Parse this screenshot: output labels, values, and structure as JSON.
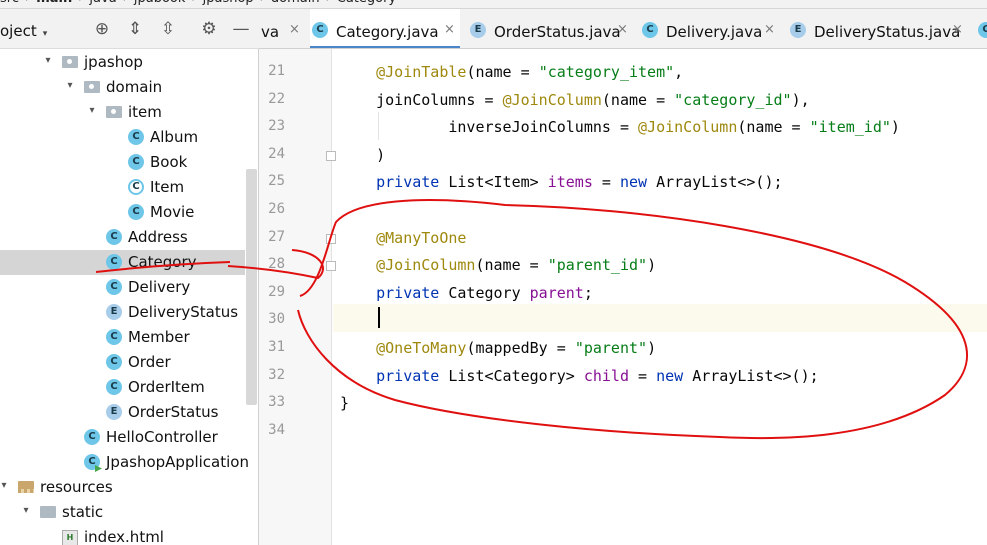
{
  "breadcrumb": [
    "src",
    "main",
    "java",
    "jpabook",
    "jpashop",
    "domain",
    "Category"
  ],
  "project_panel": {
    "title": "oject",
    "toolbar_icons": [
      "locate-icon",
      "expand-all-icon",
      "collapse-all-icon",
      "gear-icon",
      "minimize-icon"
    ],
    "tree": [
      {
        "label": "jpashop",
        "kind": "package",
        "arrow": "▾",
        "depth": 2
      },
      {
        "label": "domain",
        "kind": "package",
        "arrow": "▾",
        "depth": 3
      },
      {
        "label": "item",
        "kind": "package",
        "arrow": "▾",
        "depth": 4
      },
      {
        "label": "Album",
        "kind": "class",
        "depth": 5
      },
      {
        "label": "Book",
        "kind": "class",
        "depth": 5
      },
      {
        "label": "Item",
        "kind": "abstract",
        "depth": 5
      },
      {
        "label": "Movie",
        "kind": "class",
        "depth": 5
      },
      {
        "label": "Address",
        "kind": "class",
        "depth": 4
      },
      {
        "label": "Category",
        "kind": "class",
        "depth": 4,
        "selected": true
      },
      {
        "label": "Delivery",
        "kind": "class",
        "depth": 4
      },
      {
        "label": "DeliveryStatus",
        "kind": "enum",
        "depth": 4
      },
      {
        "label": "Member",
        "kind": "class",
        "depth": 4
      },
      {
        "label": "Order",
        "kind": "class",
        "depth": 4
      },
      {
        "label": "OrderItem",
        "kind": "class",
        "depth": 4
      },
      {
        "label": "OrderStatus",
        "kind": "enum",
        "depth": 4
      },
      {
        "label": "HelloController",
        "kind": "class",
        "depth": 3
      },
      {
        "label": "JpashopApplication",
        "kind": "app",
        "depth": 3
      },
      {
        "label": "resources",
        "kind": "resources",
        "arrow": "▾",
        "depth": 0
      },
      {
        "label": "static",
        "kind": "folder",
        "arrow": "▾",
        "depth": 1
      },
      {
        "label": "index.html",
        "kind": "html",
        "depth": 2
      }
    ]
  },
  "tabs": [
    {
      "label": "va",
      "icon": "none",
      "close": "×"
    },
    {
      "label": "Category.java",
      "icon": "C",
      "active": true,
      "close": "×"
    },
    {
      "label": "OrderStatus.java",
      "icon": "E",
      "close": "×"
    },
    {
      "label": "Delivery.java",
      "icon": "C",
      "close": "×"
    },
    {
      "label": "DeliveryStatus.java",
      "icon": "E",
      "close": "×"
    },
    {
      "label": "",
      "icon": "C",
      "close": ""
    }
  ],
  "editor": {
    "lines": [
      {
        "num": "21",
        "tokens": [
          [
            "ann",
            "    @JoinTable"
          ],
          [
            "",
            "(name = "
          ],
          [
            "str",
            "\"category_item\""
          ],
          [
            "",
            ","
          ]
        ]
      },
      {
        "num": "22",
        "tokens": [
          [
            "",
            "    joinColumns = "
          ],
          [
            "ann",
            "@JoinColumn"
          ],
          [
            "",
            "(name = "
          ],
          [
            "str",
            "\"category_id\""
          ],
          [
            "",
            "),"
          ]
        ]
      },
      {
        "num": "23",
        "tokens": [
          [
            "",
            "            inverseJoinColumns = "
          ],
          [
            "ann",
            "@JoinColumn"
          ],
          [
            "",
            "(name = "
          ],
          [
            "str",
            "\"item_id\""
          ],
          [
            "",
            ")"
          ]
        ]
      },
      {
        "num": "24",
        "tokens": [
          [
            "",
            "    )"
          ]
        ]
      },
      {
        "num": "25",
        "tokens": [
          [
            "kw",
            "    private "
          ],
          [
            "",
            "List<Item> "
          ],
          [
            "fld",
            "items"
          ],
          [
            "",
            " = "
          ],
          [
            "kw",
            "new "
          ],
          [
            "",
            "ArrayList<>();"
          ]
        ]
      },
      {
        "num": "26",
        "tokens": []
      },
      {
        "num": "27",
        "tokens": [
          [
            "ann",
            "    @ManyToOne"
          ]
        ]
      },
      {
        "num": "28",
        "tokens": [
          [
            "ann",
            "    @JoinColumn"
          ],
          [
            "",
            "(name = "
          ],
          [
            "str",
            "\"parent_id\""
          ],
          [
            "",
            ")"
          ]
        ]
      },
      {
        "num": "29",
        "tokens": [
          [
            "kw",
            "    private "
          ],
          [
            "",
            "Category "
          ],
          [
            "fld",
            "parent"
          ],
          [
            "",
            ";"
          ]
        ]
      },
      {
        "num": "30",
        "tokens": []
      },
      {
        "num": "31",
        "tokens": [
          [
            "ann",
            "    @OneToMany"
          ],
          [
            "",
            "(mappedBy = "
          ],
          [
            "str",
            "\"parent\""
          ],
          [
            "",
            ")"
          ]
        ]
      },
      {
        "num": "32",
        "tokens": [
          [
            "kw",
            "    private "
          ],
          [
            "",
            "List<Category> "
          ],
          [
            "fld",
            "child"
          ],
          [
            "",
            " = "
          ],
          [
            "kw",
            "new "
          ],
          [
            "",
            "ArrayList<>();"
          ]
        ]
      },
      {
        "num": "33",
        "tokens": [
          [
            "",
            "}"
          ]
        ]
      },
      {
        "num": "34",
        "tokens": []
      }
    ]
  },
  "colors": {
    "annotation": "#9e880d",
    "keyword": "#0033b3",
    "string": "#067d17",
    "field": "#871094",
    "scribble": "#e01010"
  }
}
